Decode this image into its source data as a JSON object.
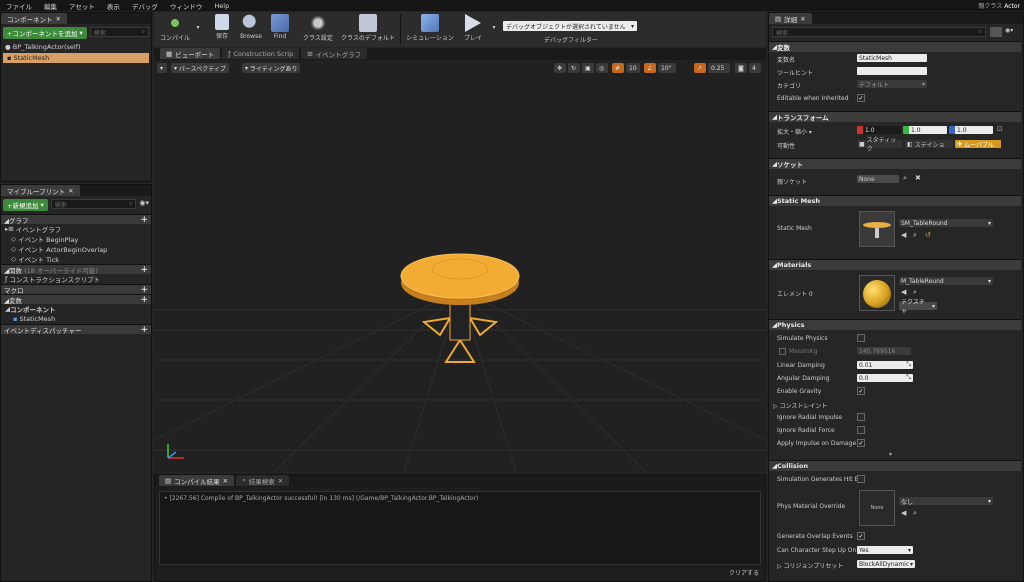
{
  "menu": [
    "ファイル",
    "編集",
    "アセット",
    "表示",
    "デバッグ",
    "ウィンドウ",
    "Help"
  ],
  "parent_class": {
    "label": "親クラス",
    "value": "Actor"
  },
  "components_panel": {
    "tab": "コンポーネント",
    "add_button": "+コンポーネントを追加",
    "search_placeholder": "検索",
    "root": "BP_TalkingActor(self)",
    "items": [
      "StaticMesh"
    ]
  },
  "myblueprint_panel": {
    "tab": "マイブループリント",
    "add_new": "+新規追加",
    "search_placeholder": "検索",
    "sections": [
      {
        "title": "グラフ",
        "items": [
          "イベントグラフ",
          "イベント BeginPlay",
          "イベント ActorBeginOverlap",
          "イベント Tick"
        ]
      },
      {
        "title": "関数",
        "note": "(18 オーバーライド可能)",
        "items": [
          "コンストラクションスクリプト"
        ]
      },
      {
        "title": "マクロ",
        "items": []
      },
      {
        "title": "変数",
        "items": []
      },
      {
        "title": "コンポーネント",
        "items": [
          "StaticMesh"
        ]
      },
      {
        "title": "イベントディスパッチャー",
        "items": []
      }
    ]
  },
  "toolbar": {
    "compile": "コンパイル",
    "save": "保存",
    "browse": "Browse",
    "find": "Find",
    "class_settings": "クラス設定",
    "class_defaults": "クラスのデフォルト",
    "simulation": "シミュレーション",
    "play": "プレイ",
    "debug_object": "デバッグオブジェクトが選択されていません",
    "debug_filter": "デバッグフィルター"
  },
  "editor_tabs": [
    "ビューポート",
    "Construction Scrip",
    "イベントグラフ"
  ],
  "viewport": {
    "perspective": "パースペクティブ",
    "lighting": "ライティングあり",
    "grid": "10",
    "angle": "10°",
    "scale": "0.25",
    "cam": "4"
  },
  "bottom_panel": {
    "tabs": [
      "コンパイル結果",
      "結果検索"
    ],
    "log": "[2267.56] Compile of BP_TalkingActor successful! [in 130 ms] (/Game/BP_TalkingActor.BP_TalkingActor)",
    "clear": "クリアする"
  },
  "details": {
    "tab": "詳細",
    "search_placeholder": "検索",
    "variable": {
      "title": "変数",
      "name_label": "変数名",
      "name_value": "StaticMesh",
      "tooltip_label": "ツールヒント",
      "category_label": "カテゴリ",
      "category_value": "デフォルト",
      "editable_label": "Editable when Inherited"
    },
    "transform": {
      "title": "トランスフォーム",
      "scale_label": "拡大・縮小",
      "x": "1.0",
      "y": "1.0",
      "z": "1.0",
      "mobility_label": "可動性",
      "static": "スタティック",
      "stationary": "ステイショ",
      "movable": "ムーバブル"
    },
    "socket": {
      "title": "ソケット",
      "parent_label": "親ソケット",
      "parent_value": "None"
    },
    "static_mesh": {
      "title": "Static Mesh",
      "label": "Static Mesh",
      "value": "SM_TableRound"
    },
    "materials": {
      "title": "Materials",
      "element_label": "エレメント 0",
      "value": "M_TableRound",
      "texture": "テクスチャ"
    },
    "physics": {
      "title": "Physics",
      "simulate": "Simulate Physics",
      "mass_label": "MassInKg",
      "mass_value": "145.769516",
      "linear_label": "Linear Damping",
      "linear_value": "0.01",
      "angular_label": "Angular Damping",
      "angular_value": "0.0",
      "gravity": "Enable Gravity",
      "constraints": "コンストレイント",
      "ignore_impulse": "Ignore Radial Impulse",
      "ignore_force": "Ignore Radial Force",
      "apply_impulse": "Apply Impulse on Damage"
    },
    "collision": {
      "title": "Collision",
      "hit_events": "Simulation Generates Hit E",
      "phys_mat_label": "Phys Material Override",
      "phys_mat_thumb": "None",
      "phys_mat_value": "なし",
      "overlap": "Generate Overlap Events",
      "step_up_label": "Can Character Step Up On",
      "step_up_value": "Yes",
      "preset_label": "コリジョンプリセット",
      "preset_value": "BlockAllDynamic"
    }
  },
  "colors": {
    "accent": "#3d8a3d",
    "selection": "#d9a066",
    "table": "#f0a830",
    "movable": "#d89a1e"
  }
}
